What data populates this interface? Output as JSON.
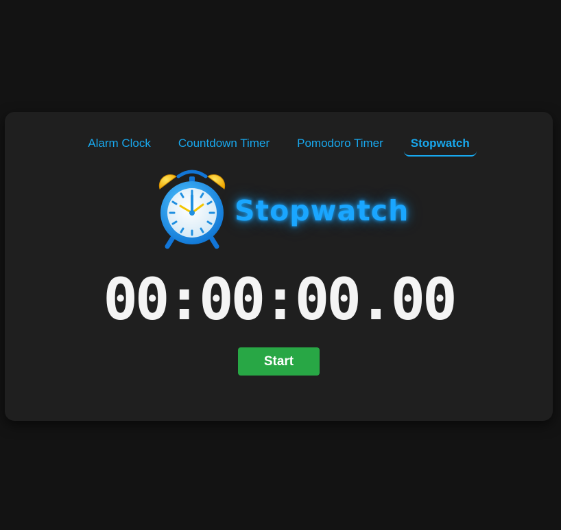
{
  "tabs": [
    {
      "label": "Alarm Clock",
      "active": false
    },
    {
      "label": "Countdown Timer",
      "active": false
    },
    {
      "label": "Pomodoro Timer",
      "active": false
    },
    {
      "label": "Stopwatch",
      "active": true
    }
  ],
  "hero": {
    "icon": "alarm-clock-icon",
    "title": "Stopwatch"
  },
  "stopwatch": {
    "time": "00:00:00.00",
    "start_label": "Start"
  },
  "colors": {
    "accent": "#18a8ee",
    "start_button": "#28a745",
    "page_background": "#131313",
    "card_background": "#1f1f1f"
  }
}
